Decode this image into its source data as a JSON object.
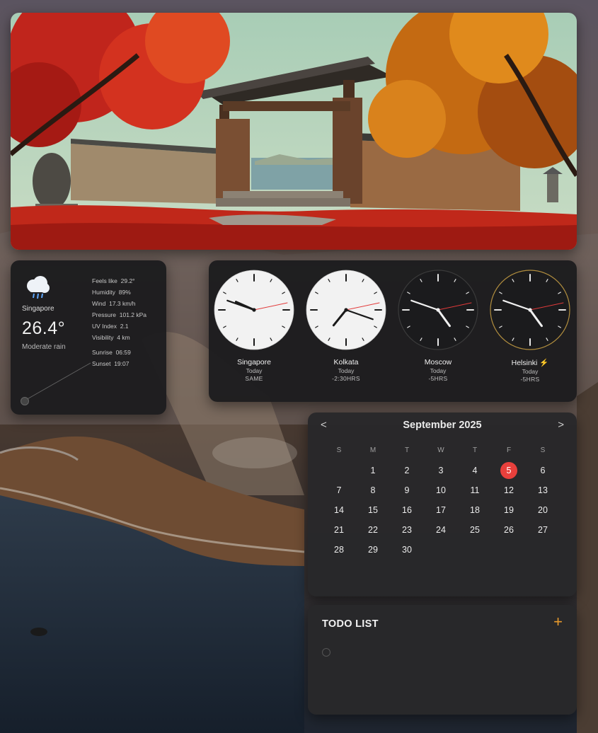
{
  "weather": {
    "city": "Singapore",
    "temperature": "26.4°",
    "condition": "Moderate rain",
    "icon": "cloud-rain-icon",
    "details": [
      {
        "label": "Feels like",
        "value": "29.2°"
      },
      {
        "label": "Humidity",
        "value": "89%"
      },
      {
        "label": "Wind",
        "value": "17.3 km/h"
      },
      {
        "label": "Pressure",
        "value": "101.2 kPa"
      },
      {
        "label": "UV Index",
        "value": "2.1"
      },
      {
        "label": "Visibility",
        "value": "4 km"
      }
    ],
    "sunrise": {
      "label": "Sunrise",
      "value": "06:59"
    },
    "sunset": {
      "label": "Sunset",
      "value": "19:07"
    }
  },
  "clocks": [
    {
      "city": "Singapore",
      "day": "Today",
      "offset": "SAME",
      "face": "light",
      "hour": 9,
      "minute": 48,
      "second": 13
    },
    {
      "city": "Kolkata",
      "day": "Today",
      "offset": "-2:30HRS",
      "face": "light",
      "hour": 7,
      "minute": 18,
      "second": 13
    },
    {
      "city": "Moscow",
      "day": "Today",
      "offset": "-5HRS",
      "face": "dark",
      "hour": 4,
      "minute": 48,
      "second": 13
    },
    {
      "city": "Helsinki ⚡",
      "day": "Today",
      "offset": "-5HRS",
      "face": "dark-gold",
      "hour": 4,
      "minute": 48,
      "second": 13
    }
  ],
  "calendar": {
    "title": "September 2025",
    "prev": "<",
    "next": ">",
    "weekdays": [
      "S",
      "M",
      "T",
      "W",
      "T",
      "F",
      "S"
    ],
    "weeks": [
      [
        "",
        "1",
        "2",
        "3",
        "4",
        "5",
        "6"
      ],
      [
        "7",
        "8",
        "9",
        "10",
        "11",
        "12",
        "13"
      ],
      [
        "14",
        "15",
        "16",
        "17",
        "18",
        "19",
        "20"
      ],
      [
        "21",
        "22",
        "23",
        "24",
        "25",
        "26",
        "27"
      ],
      [
        "28",
        "29",
        "30",
        "",
        "",
        "",
        ""
      ]
    ],
    "today": "5",
    "today_color": "#e8403c"
  },
  "todo": {
    "title": "TODO LIST",
    "add_label": "+",
    "accent": "#e89a2c",
    "input_value": ""
  }
}
